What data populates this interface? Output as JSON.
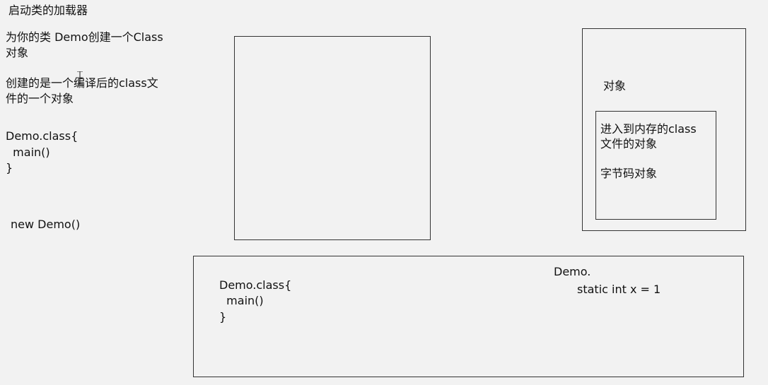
{
  "left_notes": {
    "title": "启动类的加载器",
    "line1a": "为你的类 Demo创建一个Class",
    "line1b": "对象",
    "line2a": "创建的是一个编译后的class文",
    "line2b": "件的一个对象",
    "code1": "Demo.class{",
    "code2": "  main()",
    "code3": "}",
    "new_demo": "new Demo()"
  },
  "right_box": {
    "label": "对象",
    "inner_line1": "进入到内存的class",
    "inner_line2": "文件的对象",
    "inner_line3": "字节码对象"
  },
  "bottom_box": {
    "code1": "Demo.class{",
    "code2": "  main()",
    "code3": "}",
    "demo_partial": "Demo.",
    "static_line": "static int x = 1"
  }
}
